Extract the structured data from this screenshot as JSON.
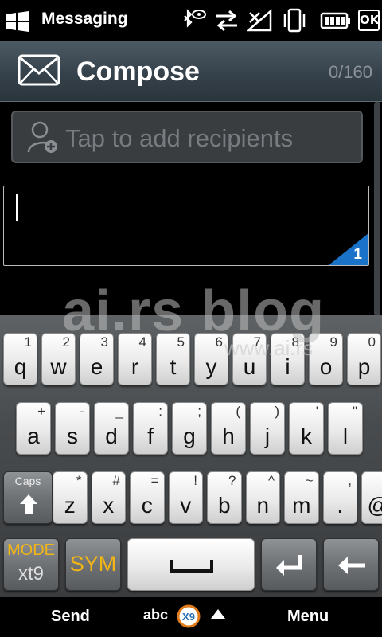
{
  "status_bar": {
    "app_name": "Messaging",
    "ok_label": "OK",
    "icons": [
      "bluetooth-icon",
      "data-transfer-icon",
      "no-signal-icon",
      "vibrate-icon",
      "battery-icon"
    ]
  },
  "header": {
    "title": "Compose",
    "counter": "0/160"
  },
  "recipients": {
    "placeholder": "Tap to add recipients"
  },
  "message": {
    "value": "",
    "segment_count": "1",
    "segment_color": "#1a73c8"
  },
  "watermark": {
    "main": "ai.rs blog",
    "sub": "www.ai.rs"
  },
  "keyboard": {
    "row1": [
      {
        "key": "q",
        "sub": "1"
      },
      {
        "key": "w",
        "sub": "2"
      },
      {
        "key": "e",
        "sub": "3"
      },
      {
        "key": "r",
        "sub": "4"
      },
      {
        "key": "t",
        "sub": "5"
      },
      {
        "key": "y",
        "sub": "6"
      },
      {
        "key": "u",
        "sub": "7"
      },
      {
        "key": "i",
        "sub": "8"
      },
      {
        "key": "o",
        "sub": "9"
      },
      {
        "key": "p",
        "sub": "0"
      }
    ],
    "row2": [
      {
        "key": "a",
        "sub": "+"
      },
      {
        "key": "s",
        "sub": "-"
      },
      {
        "key": "d",
        "sub": "_"
      },
      {
        "key": "f",
        "sub": ":"
      },
      {
        "key": "g",
        "sub": ";"
      },
      {
        "key": "h",
        "sub": "("
      },
      {
        "key": "j",
        "sub": ")"
      },
      {
        "key": "k",
        "sub": "'"
      },
      {
        "key": "l",
        "sub": "\""
      }
    ],
    "row3": [
      {
        "key": "z",
        "sub": "*"
      },
      {
        "key": "x",
        "sub": "#"
      },
      {
        "key": "c",
        "sub": "="
      },
      {
        "key": "v",
        "sub": "!"
      },
      {
        "key": "b",
        "sub": "?"
      },
      {
        "key": "n",
        "sub": "^"
      },
      {
        "key": "m",
        "sub": "~"
      },
      {
        "key": ".",
        "sub": ","
      },
      {
        "key": "@",
        "sub": "/"
      }
    ],
    "caps_label": "Caps",
    "mode_label": "MODE",
    "mode_sub": "xt9",
    "sym_label": "SYM",
    "accent_color": "#f2b516"
  },
  "softkeys": {
    "left": "Send",
    "right": "Menu",
    "input_method": "abc"
  }
}
